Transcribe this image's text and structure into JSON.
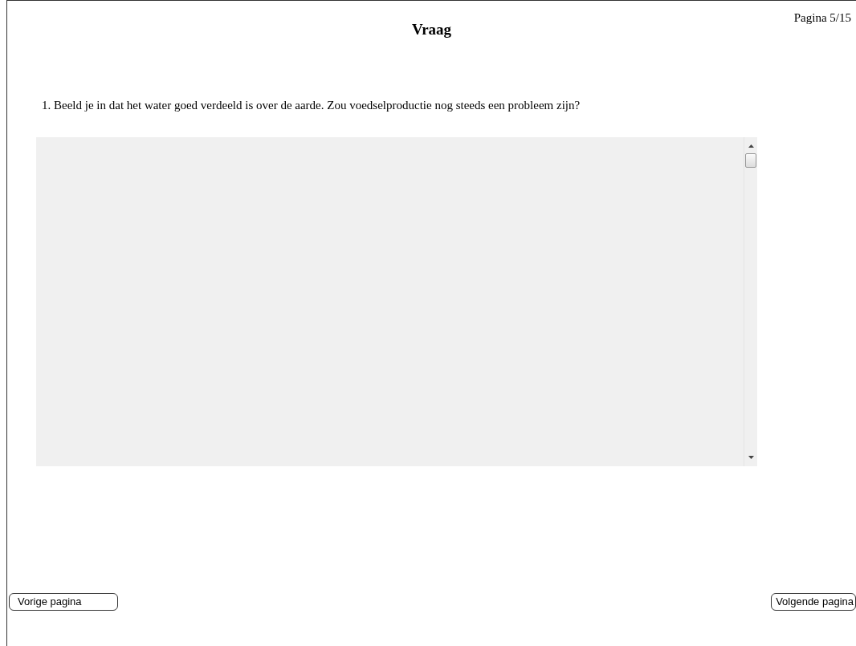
{
  "title": "Vraag",
  "page_indicator": "Pagina 5/15",
  "question": "1. Beeld je in dat het water goed verdeeld is over de aarde. Zou voedselproductie nog steeds een probleem zijn?",
  "buttons": [
    {
      "label": "Vorige pagina",
      "kind": "previous"
    },
    {
      "label": "Volgende pagina",
      "kind": "next"
    }
  ]
}
